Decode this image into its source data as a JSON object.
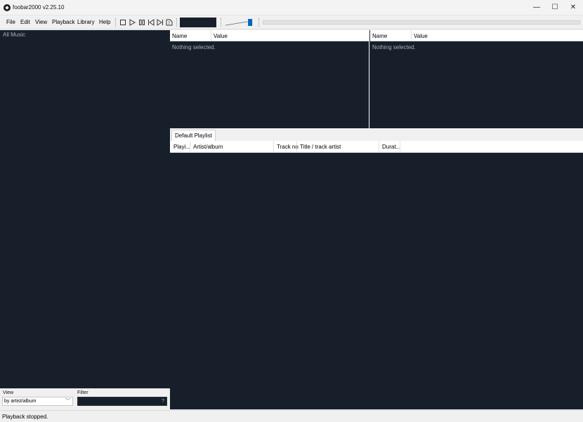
{
  "window": {
    "title": "foobar2000 v2.25.10",
    "minimize_glyph": "—",
    "maximize_glyph": "☐",
    "close_glyph": "✕"
  },
  "menu": [
    "File",
    "Edit",
    "View",
    "Playback",
    "Library",
    "Help"
  ],
  "toolbar": {
    "buttons": [
      "stop-icon",
      "play-icon",
      "pause-icon",
      "previous-icon",
      "next-icon",
      "random-icon"
    ],
    "volume_level": 0.92
  },
  "library": {
    "root_label": "All Music",
    "view_label": "View",
    "view_value": "by artist/album",
    "filter_label": "Filter",
    "filter_hint": "?"
  },
  "properties": [
    {
      "name_header": "Name",
      "value_header": "Value",
      "empty_text": "Nothing selected."
    },
    {
      "name_header": "Name",
      "value_header": "Value",
      "empty_text": "Nothing selected."
    }
  ],
  "playlist": {
    "tab_label": "Default Playlist",
    "columns": [
      "Playi...",
      "Artist/album",
      "Track no",
      "Title / track artist",
      "Durat..."
    ]
  },
  "status": {
    "text": "Playback stopped."
  },
  "colors": {
    "panel_background": "#17202a",
    "volume_accent": "#0067c0"
  }
}
